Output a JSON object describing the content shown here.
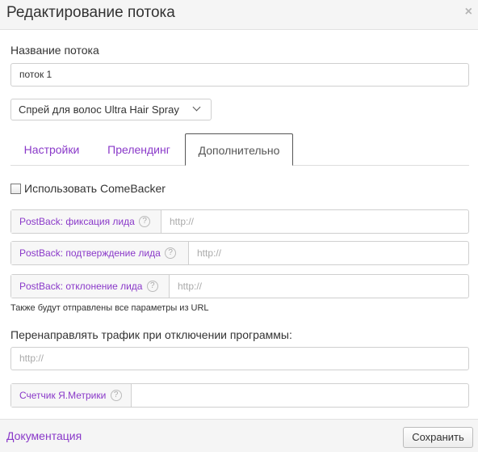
{
  "header": {
    "title": "Редактирование потока",
    "close_icon": "×"
  },
  "stream_name": {
    "label": "Название потока",
    "value": "поток 1"
  },
  "offer_select": {
    "selected": "Спрей для волос Ultra Hair Spray"
  },
  "tabs": [
    {
      "label": "Настройки"
    },
    {
      "label": "Прелендинг"
    },
    {
      "label": "Дополнительно",
      "active": true
    }
  ],
  "comeback": {
    "label": "Использовать ComeBacker",
    "checked": false
  },
  "postbacks": [
    {
      "label": "PostBack: фиксация лида",
      "placeholder": "http://"
    },
    {
      "label": "PostBack: подтверждение лида",
      "placeholder": "http://"
    },
    {
      "label": "PostBack: отклонение лида",
      "placeholder": "http://"
    }
  ],
  "help_icon": "?",
  "postback_hint": "Также будут отправлены все параметры из URL",
  "redirect": {
    "label": "Перенаправлять трафик при отключении программы:",
    "placeholder": "http://"
  },
  "metrika": {
    "label": "Счетчик Я.Метрики",
    "value": ""
  },
  "footer": {
    "docs_link": "Документация",
    "save_label": "Сохранить"
  },
  "colors": {
    "accent": "#8a39c9",
    "header_bg": "#f5f5f5",
    "border": "#cfcfcf"
  }
}
